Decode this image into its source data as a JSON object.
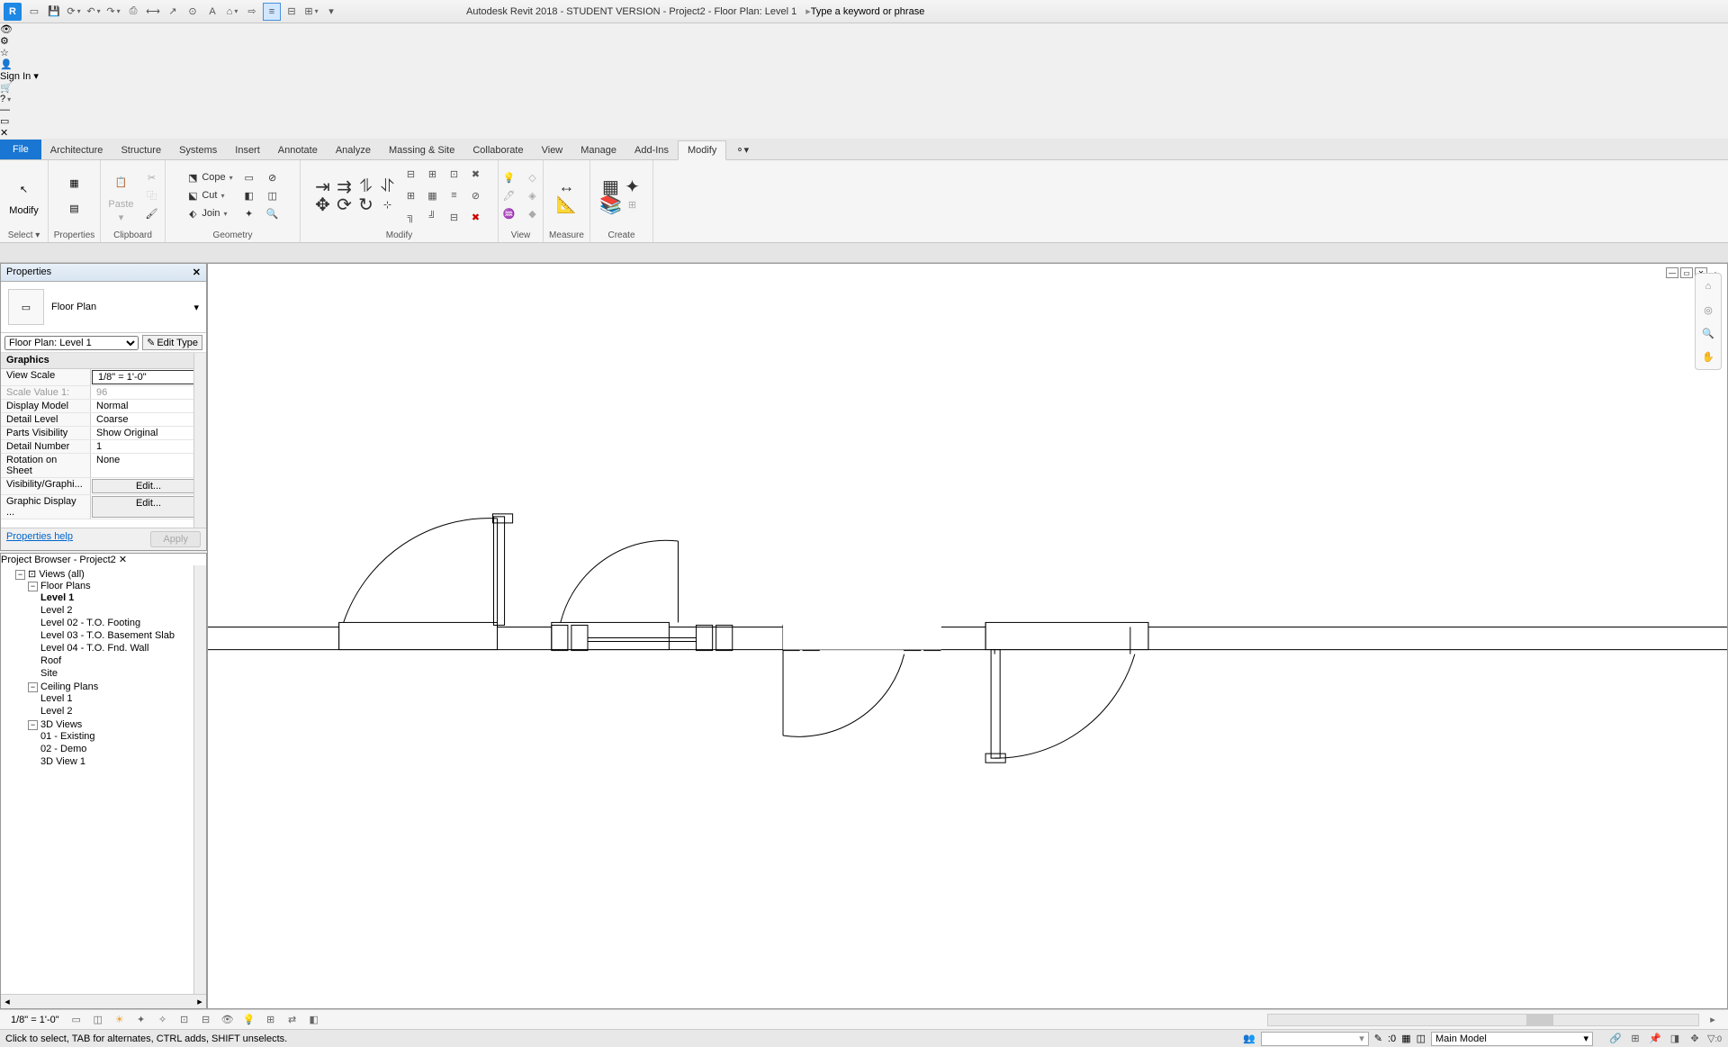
{
  "app": {
    "logo": "R",
    "title": "Autodesk Revit 2018 - STUDENT VERSION -   Project2 - Floor Plan: Level 1",
    "search_placeholder": "Type a keyword or phrase",
    "signin": "Sign In"
  },
  "tabs": {
    "file": "File",
    "items": [
      "Architecture",
      "Structure",
      "Systems",
      "Insert",
      "Annotate",
      "Analyze",
      "Massing & Site",
      "Collaborate",
      "View",
      "Manage",
      "Add-Ins",
      "Modify"
    ],
    "active": "Modify"
  },
  "ribbon": {
    "select": {
      "label": "Select ▾",
      "btn": "Modify"
    },
    "properties": {
      "label": "Properties"
    },
    "clipboard": {
      "label": "Clipboard",
      "paste": "Paste"
    },
    "geometry": {
      "label": "Geometry",
      "cope": "Cope",
      "cut": "Cut",
      "join": "Join"
    },
    "modify": {
      "label": "Modify"
    },
    "view": {
      "label": "View"
    },
    "measure": {
      "label": "Measure"
    },
    "create": {
      "label": "Create"
    }
  },
  "properties": {
    "title": "Properties",
    "type": "Floor Plan",
    "instance": "Floor Plan: Level 1",
    "edit_type": "Edit Type",
    "group": "Graphics",
    "rows": [
      {
        "k": "View Scale",
        "v": "1/8\" = 1'-0\"",
        "boxed": true
      },
      {
        "k": "Scale Value   1:",
        "v": "96",
        "dim": true
      },
      {
        "k": "Display Model",
        "v": "Normal"
      },
      {
        "k": "Detail Level",
        "v": "Coarse"
      },
      {
        "k": "Parts Visibility",
        "v": "Show Original"
      },
      {
        "k": "Detail Number",
        "v": "1"
      },
      {
        "k": "Rotation on Sheet",
        "v": "None"
      },
      {
        "k": "Visibility/Graphi...",
        "v": "Edit...",
        "btn": true
      },
      {
        "k": "Graphic Display ...",
        "v": "Edit...",
        "btn": true
      }
    ],
    "help": "Properties help",
    "apply": "Apply"
  },
  "browser": {
    "title": "Project Browser - Project2",
    "root": "Views (all)",
    "floorplans": {
      "label": "Floor Plans",
      "items": [
        "Level 1",
        "Level 2",
        "Level 02 - T.O. Footing",
        "Level 03 - T.O. Basement Slab",
        "Level 04 - T.O. Fnd. Wall",
        "Roof",
        "Site"
      ],
      "active": "Level 1"
    },
    "ceiling": {
      "label": "Ceiling Plans",
      "items": [
        "Level 1",
        "Level 2"
      ]
    },
    "views3d": {
      "label": "3D Views",
      "items": [
        "01 - Existing",
        "02 - Demo",
        "3D View 1"
      ]
    }
  },
  "viewbar": {
    "scale": "1/8\" = 1'-0\""
  },
  "status": {
    "msg": "Click to select, TAB for alternates, CTRL adds, SHIFT unselects.",
    "count": ":0",
    "workset": "Main Model",
    "filter_count": ":0"
  }
}
